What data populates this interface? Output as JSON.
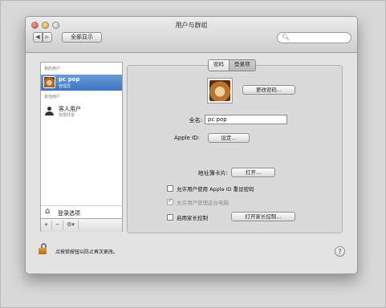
{
  "window": {
    "title": "用户与群组"
  },
  "toolbar": {
    "back_icon": "chevron-left-icon",
    "forward_icon": "chevron-right-icon",
    "show_all": "全部显示",
    "search_placeholder": ""
  },
  "sidebar": {
    "my_users_header": "我的用户",
    "selected_user": {
      "name": "pc pop",
      "role": "管理员"
    },
    "other_users_header": "其他用户",
    "guest_user": {
      "name": "客人用户",
      "desc": "仅限共享"
    },
    "login_options": "登录选项",
    "add": "+",
    "remove": "−",
    "action": "⚙▾"
  },
  "tabs": {
    "password": "密码",
    "login_items": "登录项"
  },
  "main": {
    "change_password": "更改密码...",
    "full_name_label": "全名:",
    "full_name_value": "pc pop",
    "apple_id_label": "Apple ID:",
    "apple_id_button": "设定...",
    "contacts_label": "地址簿卡片:",
    "contacts_button": "打开...",
    "reset_with_apple_id": "允许用户使用 Apple ID 重设密码",
    "allow_admin": "允许用户管理这台电脑",
    "parental_controls": "启用家长控制",
    "open_parental": "打开家长控制..."
  },
  "footer": {
    "lock_text": "点按锁按钮以防止再次更改。",
    "help": "?"
  }
}
